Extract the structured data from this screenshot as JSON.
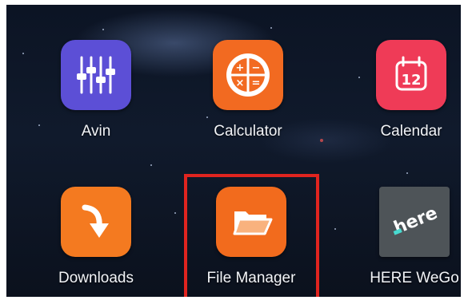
{
  "apps": [
    {
      "label": "Avin",
      "icon": "equalizer-icon",
      "color": "#5c4fd6"
    },
    {
      "label": "Calculator",
      "icon": "calculator-icon",
      "color": "#f26a21"
    },
    {
      "label": "Calendar",
      "icon": "calendar-icon",
      "color": "#ef3b57"
    },
    {
      "label": "Downloads",
      "icon": "download-arrow-icon",
      "color": "#f47a20"
    },
    {
      "label": "File Manager",
      "icon": "folder-icon",
      "color": "#f26b1d"
    },
    {
      "label": "HERE WeGo",
      "icon": "here-logo-icon",
      "color": "#4e5458"
    }
  ],
  "calendar_day": "12",
  "here_logo_text": "here",
  "calculator_symbols": [
    "+",
    "−",
    "×",
    "="
  ],
  "highlight_color": "#e0241f"
}
